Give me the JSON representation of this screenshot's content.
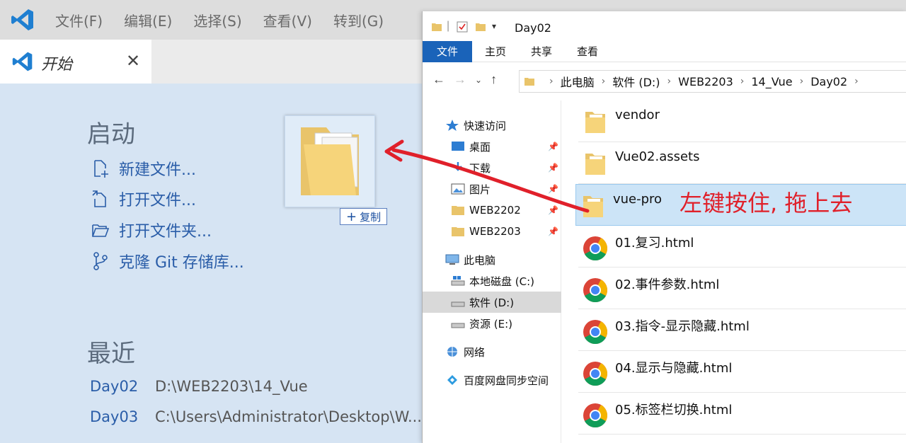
{
  "vscode": {
    "menu": [
      "文件(F)",
      "编辑(E)",
      "选择(S)",
      "查看(V)",
      "转到(G)"
    ],
    "tab_label": "开始",
    "start_heading": "启动",
    "start_links": [
      "新建文件...",
      "打开文件...",
      "打开文件夹...",
      "克隆 Git 存储库..."
    ],
    "recent_heading": "最近",
    "recent": [
      {
        "name": "Day02",
        "path": "D:\\WEB2203\\14_Vue"
      },
      {
        "name": "Day03",
        "path": "C:\\Users\\Administrator\\Desktop\\W..."
      }
    ]
  },
  "drag": {
    "badge_label": "复制"
  },
  "explorer": {
    "title": "Day02",
    "ribbon_tabs": [
      "文件",
      "主页",
      "共享",
      "查看"
    ],
    "breadcrumb": [
      "此电脑",
      "软件 (D:)",
      "WEB2203",
      "14_Vue",
      "Day02"
    ],
    "nav_items": [
      {
        "label": "快速访问",
        "icon": "star-icon",
        "pinned": false
      },
      {
        "label": "桌面",
        "icon": "desktop-icon",
        "pinned": true
      },
      {
        "label": "下载",
        "icon": "download-icon",
        "pinned": true
      },
      {
        "label": "图片",
        "icon": "pictures-icon",
        "pinned": true
      },
      {
        "label": "WEB2202",
        "icon": "folder-icon",
        "pinned": true
      },
      {
        "label": "WEB2203",
        "icon": "folder-icon",
        "pinned": true
      },
      {
        "label": "此电脑",
        "icon": "computer-icon",
        "pinned": false
      },
      {
        "label": "本地磁盘 (C:)",
        "icon": "drive-icon",
        "pinned": false
      },
      {
        "label": "软件 (D:)",
        "icon": "drive-icon",
        "pinned": false
      },
      {
        "label": "资源 (E:)",
        "icon": "drive-icon",
        "pinned": false
      },
      {
        "label": "网络",
        "icon": "network-icon",
        "pinned": false
      },
      {
        "label": "百度网盘同步空间",
        "icon": "baidu-icon",
        "pinned": false
      }
    ],
    "files": [
      {
        "name": "vendor",
        "type": "folder"
      },
      {
        "name": "Vue02.assets",
        "type": "folder"
      },
      {
        "name": "vue-pro",
        "type": "folder"
      },
      {
        "name": "01.复习.html",
        "type": "chrome"
      },
      {
        "name": "02.事件参数.html",
        "type": "chrome"
      },
      {
        "name": "03.指令-显示隐藏.html",
        "type": "chrome"
      },
      {
        "name": "04.显示与隐藏.html",
        "type": "chrome"
      },
      {
        "name": "05.标签栏切换.html",
        "type": "chrome"
      }
    ]
  },
  "annotation": "左键按住, 拖上去",
  "colors": {
    "accent": "#1a63b9",
    "link": "#2a5da8",
    "annotation": "#e0202a"
  }
}
